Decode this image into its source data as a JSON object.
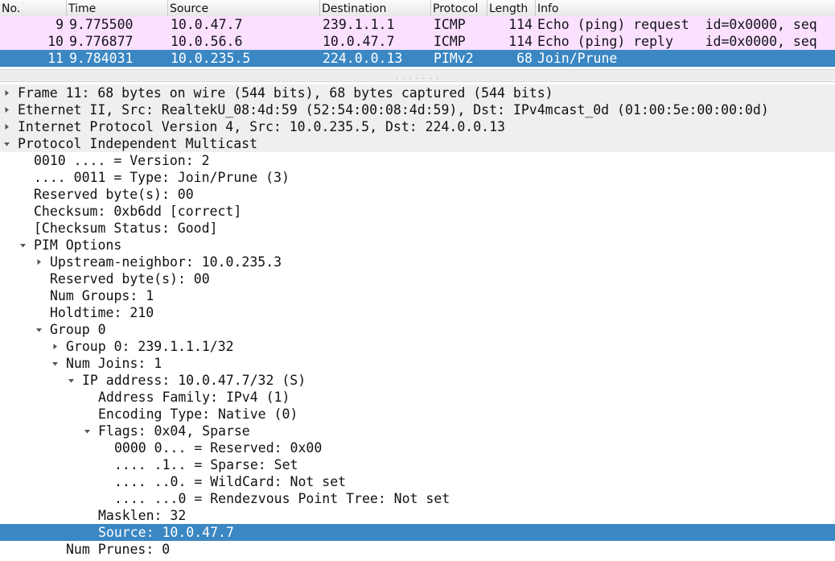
{
  "packet_list": {
    "columns": [
      "No.",
      "Time",
      "Source",
      "Destination",
      "Protocol",
      "Length",
      "Info"
    ],
    "rows": [
      {
        "no": "9",
        "time": "9.775500",
        "source": "10.0.47.7",
        "destination": "239.1.1.1",
        "protocol": "ICMP",
        "length": "114",
        "info": "Echo (ping) request  id=0x0000, seq"
      },
      {
        "no": "10",
        "time": "9.776877",
        "source": "10.0.56.6",
        "destination": "10.0.47.7",
        "protocol": "ICMP",
        "length": "114",
        "info": "Echo (ping) reply    id=0x0000, seq"
      },
      {
        "no": "11",
        "time": "9.784031",
        "source": "10.0.235.5",
        "destination": "224.0.0.13",
        "protocol": "PIMv2",
        "length": "68",
        "info": "Join/Prune"
      }
    ],
    "selected_row": "11",
    "colors": {
      "icmp_row": "#fce0ff",
      "selected_row": "#3a87c3"
    }
  },
  "details": {
    "lines": [
      {
        "text": "Frame 11: 68 bytes on wire (544 bits), 68 bytes captured (544 bits)",
        "state": "collapsed"
      },
      {
        "text": "Ethernet II, Src: RealtekU_08:4d:59 (52:54:00:08:4d:59), Dst: IPv4mcast_0d (01:00:5e:00:00:0d)",
        "state": "collapsed"
      },
      {
        "text": "Internet Protocol Version 4, Src: 10.0.235.5, Dst: 224.0.0.13",
        "state": "collapsed"
      },
      {
        "text": "Protocol Independent Multicast",
        "state": "expanded"
      },
      {
        "text": "0010 .... = Version: 2",
        "state": "leaf"
      },
      {
        "text": ".... 0011 = Type: Join/Prune (3)",
        "state": "leaf"
      },
      {
        "text": "Reserved byte(s): 00",
        "state": "leaf"
      },
      {
        "text": "Checksum: 0xb6dd [correct]",
        "state": "leaf"
      },
      {
        "text": "[Checksum Status: Good]",
        "state": "leaf"
      },
      {
        "text": "PIM Options",
        "state": "expanded"
      },
      {
        "text": "Upstream-neighbor: 10.0.235.3",
        "state": "collapsed"
      },
      {
        "text": "Reserved byte(s): 00",
        "state": "leaf"
      },
      {
        "text": "Num Groups: 1",
        "state": "leaf"
      },
      {
        "text": "Holdtime: 210",
        "state": "leaf"
      },
      {
        "text": "Group 0",
        "state": "expanded"
      },
      {
        "text": "Group 0: 239.1.1.1/32",
        "state": "collapsed"
      },
      {
        "text": "Num Joins: 1",
        "state": "expanded"
      },
      {
        "text": "IP address: 10.0.47.7/32 (S)",
        "state": "expanded"
      },
      {
        "text": "Address Family: IPv4 (1)",
        "state": "leaf"
      },
      {
        "text": "Encoding Type: Native (0)",
        "state": "leaf"
      },
      {
        "text": "Flags: 0x04, Sparse",
        "state": "expanded"
      },
      {
        "text": "0000 0... = Reserved: 0x00",
        "state": "leaf"
      },
      {
        "text": ".... .1.. = Sparse: Set",
        "state": "leaf"
      },
      {
        "text": ".... ..0. = WildCard: Not set",
        "state": "leaf"
      },
      {
        "text": ".... ...0 = Rendezvous Point Tree: Not set",
        "state": "leaf"
      },
      {
        "text": "Masklen: 32",
        "state": "leaf"
      },
      {
        "text": "Source: 10.0.47.7",
        "state": "leaf"
      },
      {
        "text": "Num Prunes: 0",
        "state": "leaf"
      }
    ],
    "selected_line": "Source: 10.0.47.7"
  }
}
